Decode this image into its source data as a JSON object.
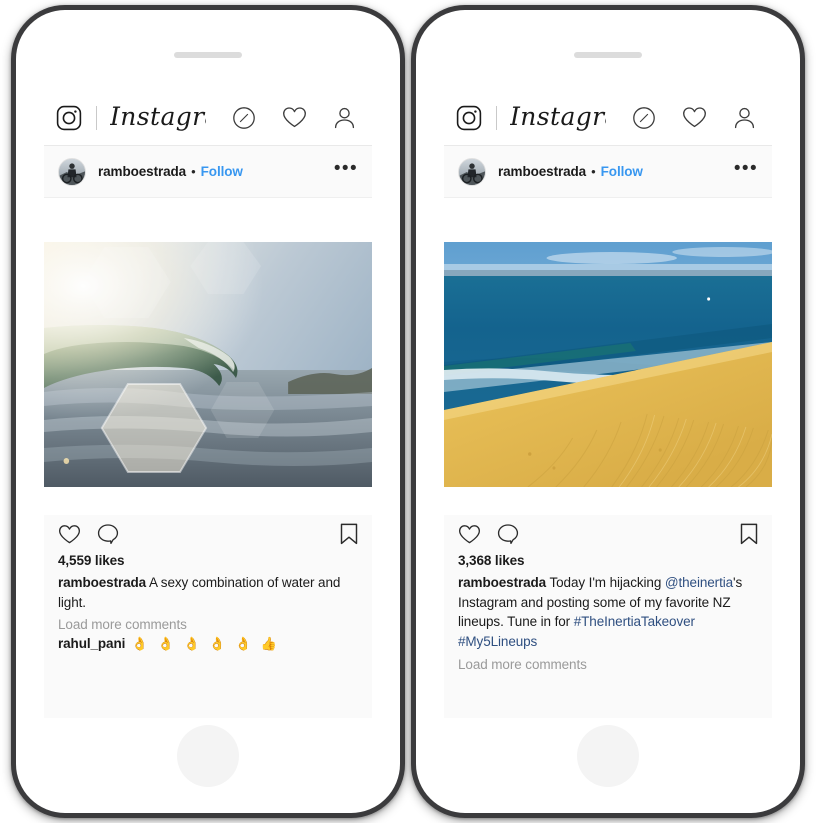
{
  "app": {
    "name": "Instagram",
    "wordmark": "Instagram",
    "nav_icons": [
      "camera-logo-icon",
      "explore-compass-icon",
      "activity-heart-icon",
      "profile-person-icon"
    ]
  },
  "colors": {
    "link_blue": "#3897f0",
    "caption_link": "#2f4f80",
    "text": "#1b1b1b",
    "muted": "#9a9a9a",
    "card_bg": "#fafafa",
    "frame": "#3b3b3d"
  },
  "phones": [
    {
      "id": "phone-left",
      "post": {
        "username": "ramboestrada",
        "separator": "•",
        "follow_label": "Follow",
        "more_label": "•••",
        "likes": "4,559 likes",
        "caption_author": "ramboestrada",
        "caption_text": " A sexy combination of water and light.",
        "load_more": "Load more comments",
        "comment_author": "rahul_pani",
        "comment_text": " 👌 👌 👌 👌 👌 👍",
        "has_tag_badge": false,
        "photo_alt": "breaking-ocean-wave-with-sun-flare"
      }
    },
    {
      "id": "phone-right",
      "post": {
        "username": "ramboestrada",
        "separator": "•",
        "follow_label": "Follow",
        "more_label": "•••",
        "likes": "3,368 likes",
        "caption_author": "ramboestrada",
        "caption_text": " Today I'm hijacking ",
        "caption_mention": "@theinertia",
        "caption_text2": "'s Instagram and posting some of my favorite NZ lineups. Tune in for ",
        "caption_hashtag1": "#TheInertiaTakeover",
        "caption_hashtag2": "#My5Lineups",
        "load_more": "Load more comments",
        "has_tag_badge": true,
        "photo_alt": "sand-dune-overlooking-blue-ocean-with-wave-line"
      }
    }
  ]
}
